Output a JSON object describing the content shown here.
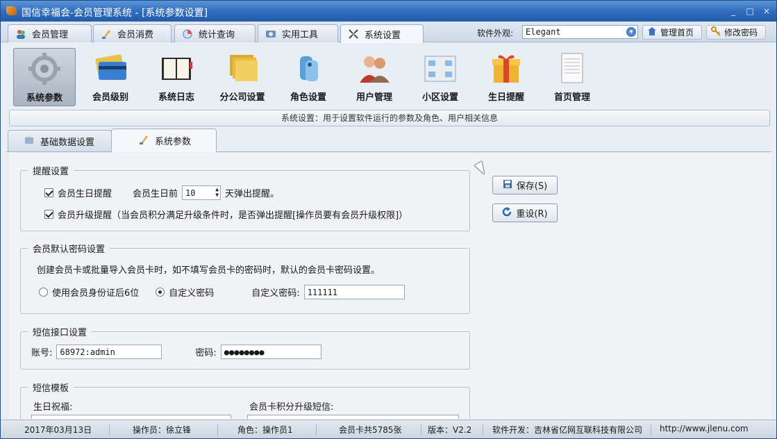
{
  "window": {
    "title": "国信幸福会-会员管理系统 - [系统参数设置]",
    "controls": [
      "_",
      "□",
      "×"
    ]
  },
  "main_tabs": [
    {
      "label": "会员管理",
      "icon": "members-icon"
    },
    {
      "label": "会员消费",
      "icon": "consume-icon"
    },
    {
      "label": "统计查询",
      "icon": "statistics-icon"
    },
    {
      "label": "实用工具",
      "icon": "tools-icon"
    },
    {
      "label": "系统设置",
      "icon": "settings-icon",
      "active": true
    }
  ],
  "toolbar": {
    "skin_label": "软件外观:",
    "skin_value": "Elegant",
    "home_label": "管理首页",
    "password_label": "修改密码"
  },
  "ribbon": {
    "buttons": [
      {
        "label": "系统参数",
        "icon": "gear-icon",
        "active": true
      },
      {
        "label": "会员级别",
        "icon": "card-icon"
      },
      {
        "label": "系统日志",
        "icon": "book-icon"
      },
      {
        "label": "分公司设置",
        "icon": "folder-icon"
      },
      {
        "label": "角色设置",
        "icon": "role-icon"
      },
      {
        "label": "用户管理",
        "icon": "users-icon"
      },
      {
        "label": "小区设置",
        "icon": "community-icon"
      },
      {
        "label": "生日提醒",
        "icon": "gift-icon"
      },
      {
        "label": "首页管理",
        "icon": "document-icon"
      }
    ],
    "info": "系统设置：用于设置软件运行的参数及角色、用户相关信息"
  },
  "sub_tabs": [
    {
      "label": "基础数据设置",
      "icon": "data-icon"
    },
    {
      "label": "系统参数",
      "icon": "brush-icon",
      "active": true
    }
  ],
  "reminder": {
    "legend": "提醒设置",
    "birthday_checkbox": "会员生日提醒",
    "birthday_before": "会员生日前",
    "days_value": "10",
    "days_suffix": "天弹出提醒。",
    "upgrade_checkbox": "会员升级提醒（当会员积分满足升级条件时，是否弹出提醒[操作员要有会员升级权限]）"
  },
  "password": {
    "legend": "会员默认密码设置",
    "desc": "创建会员卡或批量导入会员卡时，如不填写会员卡的密码时，默认的会员卡密码设置。",
    "option_id": "使用会员身份证后6位",
    "option_custom": "自定义密码",
    "custom_label": "自定义密码:",
    "custom_value": "111111"
  },
  "sms": {
    "legend": "短信接口设置",
    "account_label": "账号:",
    "account_value": "68972:admin",
    "pwd_label": "密码:",
    "pwd_value": "●●●●●●●●"
  },
  "template": {
    "legend": "短信模板",
    "birthday_label": "生日祝福:",
    "upgrade_label": "会员卡积分升级短信:"
  },
  "actions": {
    "save": "保存(S)",
    "reset": "重设(R)"
  },
  "status": {
    "date": "2017年03月13日",
    "operator": "操作员：徐立锋",
    "role": "角色：操作员1",
    "cards": "会员卡共5785张",
    "version": "版本：V2.2",
    "developer": "软件开发：吉林省亿网互联科技有限公司",
    "url": "http://www.jlenu.com"
  }
}
